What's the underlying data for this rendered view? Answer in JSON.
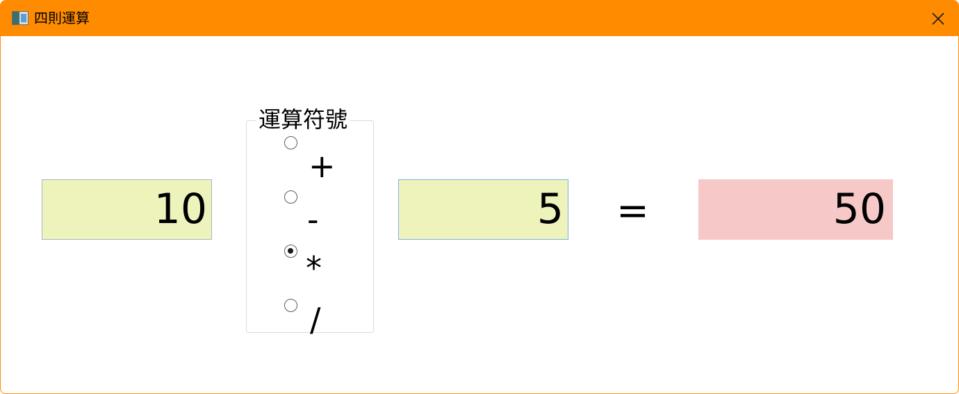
{
  "window": {
    "title": "四則運算",
    "titlebar_color": "#ff8c00"
  },
  "calculator": {
    "operand1": "10",
    "operand2": "5",
    "equals": "=",
    "result": "50",
    "operator_group": {
      "title": "運算符號",
      "options": [
        {
          "label": "+",
          "checked": false
        },
        {
          "label": "-",
          "checked": false
        },
        {
          "label": "*",
          "checked": true
        },
        {
          "label": "/",
          "checked": false
        }
      ]
    }
  },
  "colors": {
    "input_bg": "#eef3bb",
    "result_bg": "#f7c8c8"
  },
  "icons": {
    "app": "app-icon",
    "close": "close-icon"
  }
}
